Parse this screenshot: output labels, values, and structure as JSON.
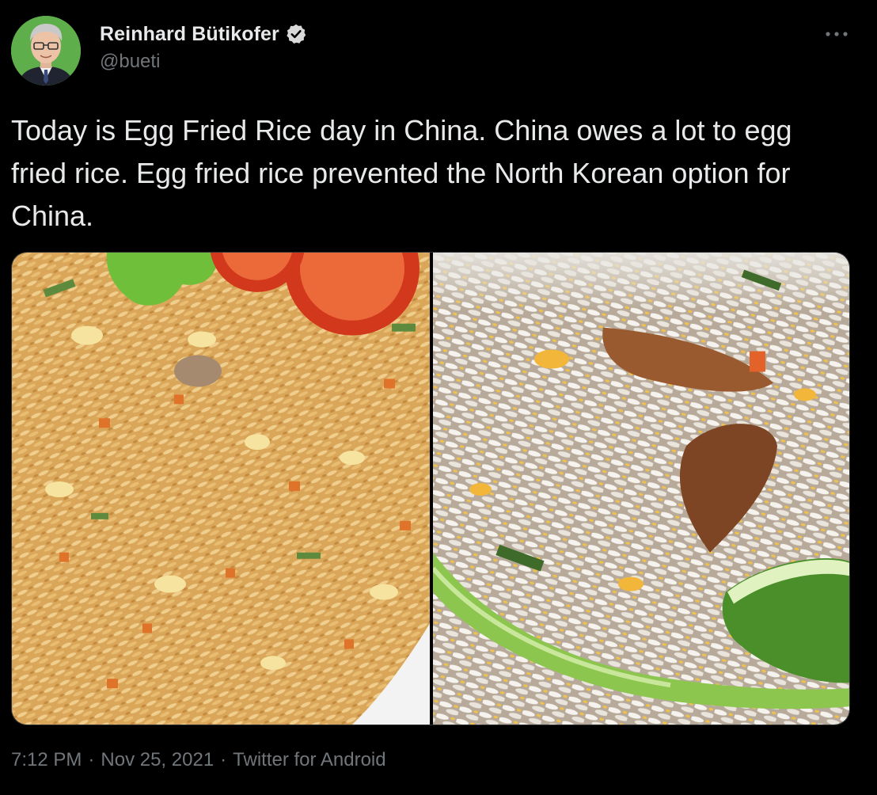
{
  "author": {
    "name": "Reinhard Bütikofer",
    "handle": "@bueti",
    "verified": true,
    "avatar_icon": "profile-photo"
  },
  "tweet": {
    "text": "Today is Egg Fried Rice day in China. China owes a lot to egg fried rice. Egg fried rice prevented the North Korean option for China."
  },
  "media": {
    "images": [
      {
        "subject": "egg-fried-rice-with-tomato-and-lettuce"
      },
      {
        "subject": "egg-fried-rice-with-green-onion-and-lime"
      }
    ]
  },
  "footer": {
    "time": "7:12 PM",
    "separator": "·",
    "date": "Nov 25, 2021",
    "source": "Twitter for Android"
  },
  "icons": {
    "verified": "verified-badge-icon",
    "more": "more-options-icon"
  },
  "colors": {
    "background": "#000000",
    "text_primary": "#e7e9ea",
    "text_secondary": "#71767b"
  }
}
